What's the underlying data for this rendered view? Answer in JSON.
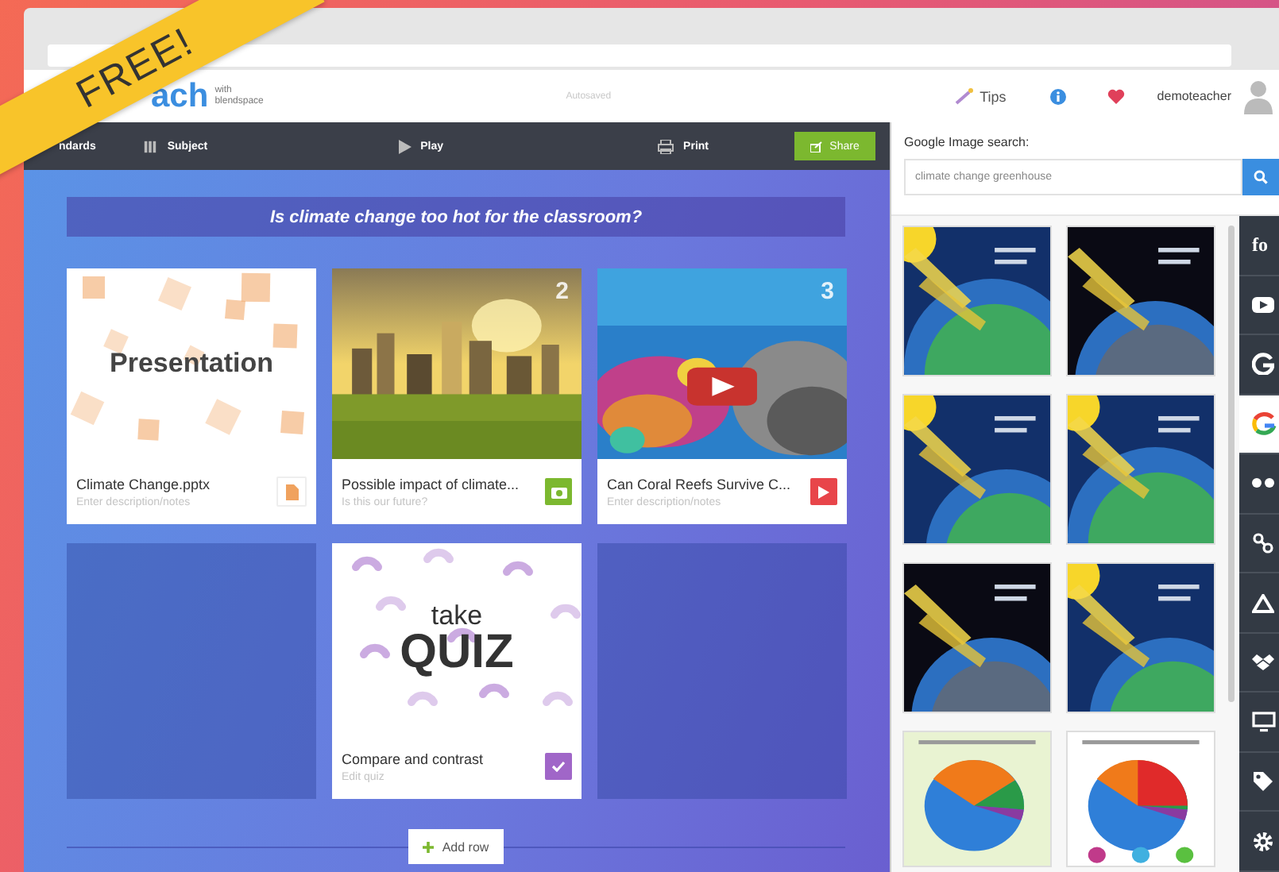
{
  "ribbon": {
    "label": "FREE!"
  },
  "header": {
    "logo": "ach",
    "tagline": "with blendspace",
    "status": "Autosaved",
    "tips": "Tips",
    "user": "demoteacher"
  },
  "toolbar": {
    "items": [
      {
        "kind": "standards",
        "label": "ndards"
      },
      {
        "kind": "subject",
        "label": "Subject"
      },
      {
        "kind": "play",
        "label": "Play"
      },
      {
        "kind": "print",
        "label": "Print"
      }
    ],
    "share": "Share"
  },
  "lesson": {
    "title": "Is climate change too hot for the classroom?",
    "tiles": [
      {
        "kind": "presentation",
        "thumb_text": "Presentation",
        "title": "Climate Change.pptx",
        "note": "Enter description/notes",
        "color": "#f0a25e"
      },
      {
        "number": "2",
        "title": "Possible impact of climate...",
        "note": "Is this our future?",
        "color": "#7cb82f"
      },
      {
        "kind": "video",
        "number": "3",
        "title": "Can Coral Reefs Survive C...",
        "note": "Enter description/notes",
        "color": "#e8454a"
      },
      {
        "kind": "empty"
      },
      {
        "kind": "quiz",
        "thumb_small": "take",
        "thumb_big": "QUIZ",
        "title": "Compare and contrast",
        "note": "Edit quiz",
        "color": "#a066c8"
      },
      {
        "kind": "empty"
      }
    ],
    "add_row": "Add row"
  },
  "image_search": {
    "label": "Google Image search:",
    "query": "climate change greenhouse"
  },
  "sources": [
    {
      "kind": "text",
      "label": "fo",
      "selected": false
    },
    {
      "kind": "youtube",
      "selected": false
    },
    {
      "kind": "google",
      "selected": false
    },
    {
      "kind": "google-color",
      "selected": true
    },
    {
      "kind": "dots",
      "selected": false
    },
    {
      "kind": "share",
      "selected": false
    },
    {
      "kind": "drive",
      "selected": false
    },
    {
      "kind": "dropbox",
      "selected": false
    },
    {
      "kind": "monitor",
      "selected": false
    },
    {
      "kind": "tag",
      "selected": false
    },
    {
      "kind": "settings",
      "selected": false
    }
  ]
}
